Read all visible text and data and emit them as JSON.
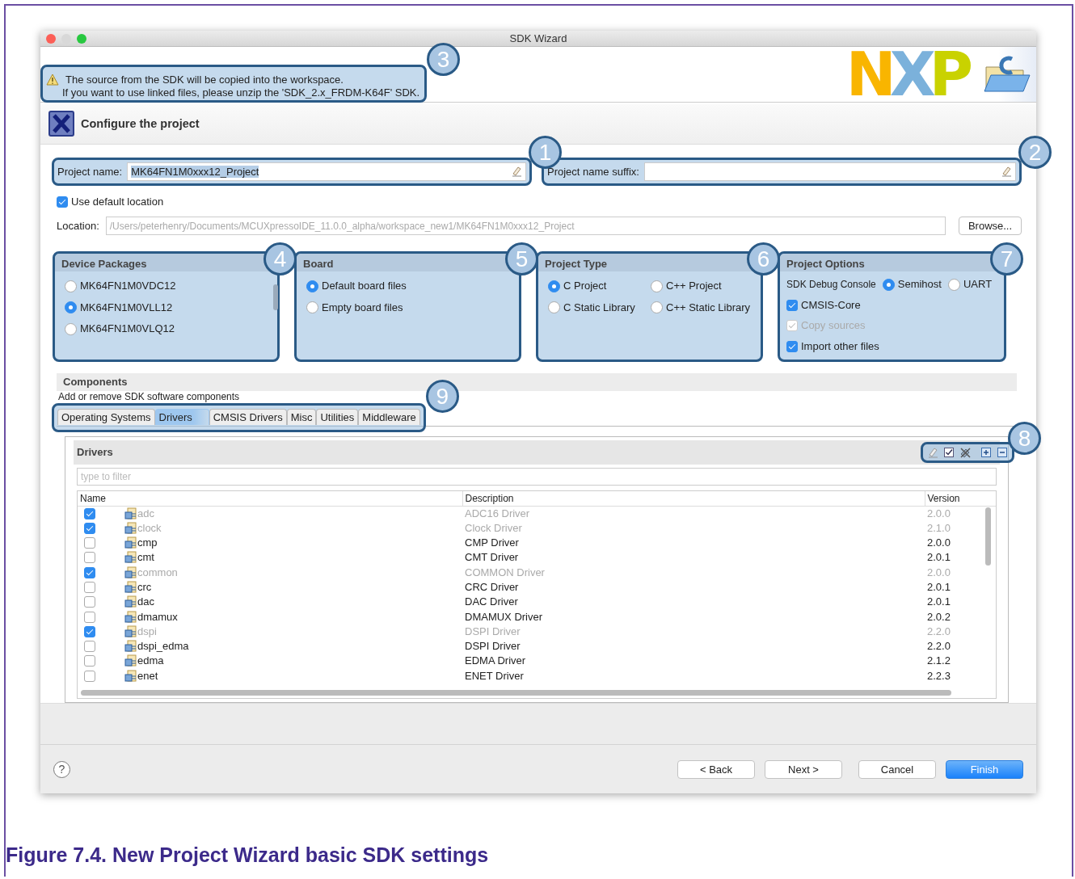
{
  "window": {
    "title": "SDK Wizard"
  },
  "notice": {
    "lines": [
      "The source from the SDK will be copied into the workspace.",
      "If you want to use linked files, please unzip the 'SDK_2.x_FRDM-K64F' SDK."
    ],
    "callout": "3"
  },
  "logo": {
    "text": "NXP"
  },
  "page_header": {
    "title": "Configure the project"
  },
  "project_name": {
    "label": "Project name:",
    "value": "MK64FN1M0xxx12_Project",
    "callout": "1"
  },
  "name_suffix": {
    "label": "Project name suffix:",
    "callout": "2"
  },
  "use_default_location": {
    "label": "Use default location",
    "checked": true
  },
  "location": {
    "label": "Location:",
    "value": "/Users/peterhenry/Documents/MCUXpressoIDE_11.0.0_alpha/workspace_new1/MK64FN1M0xxx12_Project",
    "disabled": true,
    "browse_button": "Browse..."
  },
  "groups": [
    {
      "kind": "radio_list",
      "title": "Device Packages",
      "callout": "4",
      "options": [
        {
          "label": "MK64FN1M0VDC12",
          "selected": false
        },
        {
          "label": "MK64FN1M0VLL12",
          "selected": true
        },
        {
          "label": "MK64FN1M0VLQ12",
          "selected": false
        }
      ]
    },
    {
      "kind": "radio_list",
      "title": "Board",
      "callout": "5",
      "options": [
        {
          "label": "Default board files",
          "selected": true
        },
        {
          "label": "Empty board files",
          "selected": false
        }
      ]
    },
    {
      "kind": "radio_grid",
      "title": "Project Type",
      "callout": "6",
      "options": [
        {
          "label": "C Project",
          "selected": true
        },
        {
          "label": "C++ Project",
          "selected": false
        },
        {
          "label": "C Static Library",
          "selected": false
        },
        {
          "label": "C++ Static Library",
          "selected": false
        }
      ]
    },
    {
      "kind": "options",
      "title": "Project Options",
      "callout": "7",
      "debug_console": {
        "label": "SDK Debug Console",
        "options": [
          {
            "label": "Semihost",
            "selected": true
          },
          {
            "label": "UART",
            "selected": false
          }
        ]
      },
      "checkboxes": [
        {
          "label": "CMSIS-Core",
          "checked": true,
          "disabled": false
        },
        {
          "label": "Copy sources",
          "checked": true,
          "disabled": true
        },
        {
          "label": "Import other files",
          "checked": true,
          "disabled": false
        }
      ]
    }
  ],
  "components": {
    "title": "Components",
    "subtitle": "Add or remove SDK software components",
    "tabs_callout": "9",
    "tabs": [
      {
        "label": "Operating Systems",
        "selected": false
      },
      {
        "label": "Drivers",
        "selected": true
      },
      {
        "label": "CMSIS Drivers",
        "selected": false
      },
      {
        "label": "Misc",
        "selected": false
      },
      {
        "label": "Utilities",
        "selected": false
      },
      {
        "label": "Middleware",
        "selected": false
      }
    ],
    "panel": {
      "title": "Drivers",
      "toolbar_callout": "8",
      "filter_placeholder": "type to filter",
      "columns": [
        "Name",
        "Description",
        "Version"
      ],
      "rows": [
        {
          "name": "adc",
          "description": "ADC16 Driver",
          "version": "2.0.0",
          "checked": true,
          "disabled": true
        },
        {
          "name": "clock",
          "description": "Clock Driver",
          "version": "2.1.0",
          "checked": true,
          "disabled": true
        },
        {
          "name": "cmp",
          "description": "CMP Driver",
          "version": "2.0.0",
          "checked": false,
          "disabled": false
        },
        {
          "name": "cmt",
          "description": "CMT Driver",
          "version": "2.0.1",
          "checked": false,
          "disabled": false
        },
        {
          "name": "common",
          "description": "COMMON Driver",
          "version": "2.0.0",
          "checked": true,
          "disabled": true
        },
        {
          "name": "crc",
          "description": "CRC Driver",
          "version": "2.0.1",
          "checked": false,
          "disabled": false
        },
        {
          "name": "dac",
          "description": "DAC Driver",
          "version": "2.0.1",
          "checked": false,
          "disabled": false
        },
        {
          "name": "dmamux",
          "description": "DMAMUX Driver",
          "version": "2.0.2",
          "checked": false,
          "disabled": false
        },
        {
          "name": "dspi",
          "description": "DSPI Driver",
          "version": "2.2.0",
          "checked": true,
          "disabled": true
        },
        {
          "name": "dspi_edma",
          "description": "DSPI Driver",
          "version": "2.2.0",
          "checked": false,
          "disabled": false
        },
        {
          "name": "edma",
          "description": "EDMA Driver",
          "version": "2.1.2",
          "checked": false,
          "disabled": false
        },
        {
          "name": "enet",
          "description": "ENET Driver",
          "version": "2.2.3",
          "checked": false,
          "disabled": false
        }
      ]
    }
  },
  "footer": {
    "help_icon": "?",
    "buttons": [
      {
        "label": "< Back",
        "default": false
      },
      {
        "label": "Next >",
        "default": false
      },
      {
        "label": "Cancel",
        "default": false
      },
      {
        "label": "Finish",
        "default": true
      }
    ]
  },
  "caption": "Figure 7.4. New Project Wizard basic SDK settings"
}
